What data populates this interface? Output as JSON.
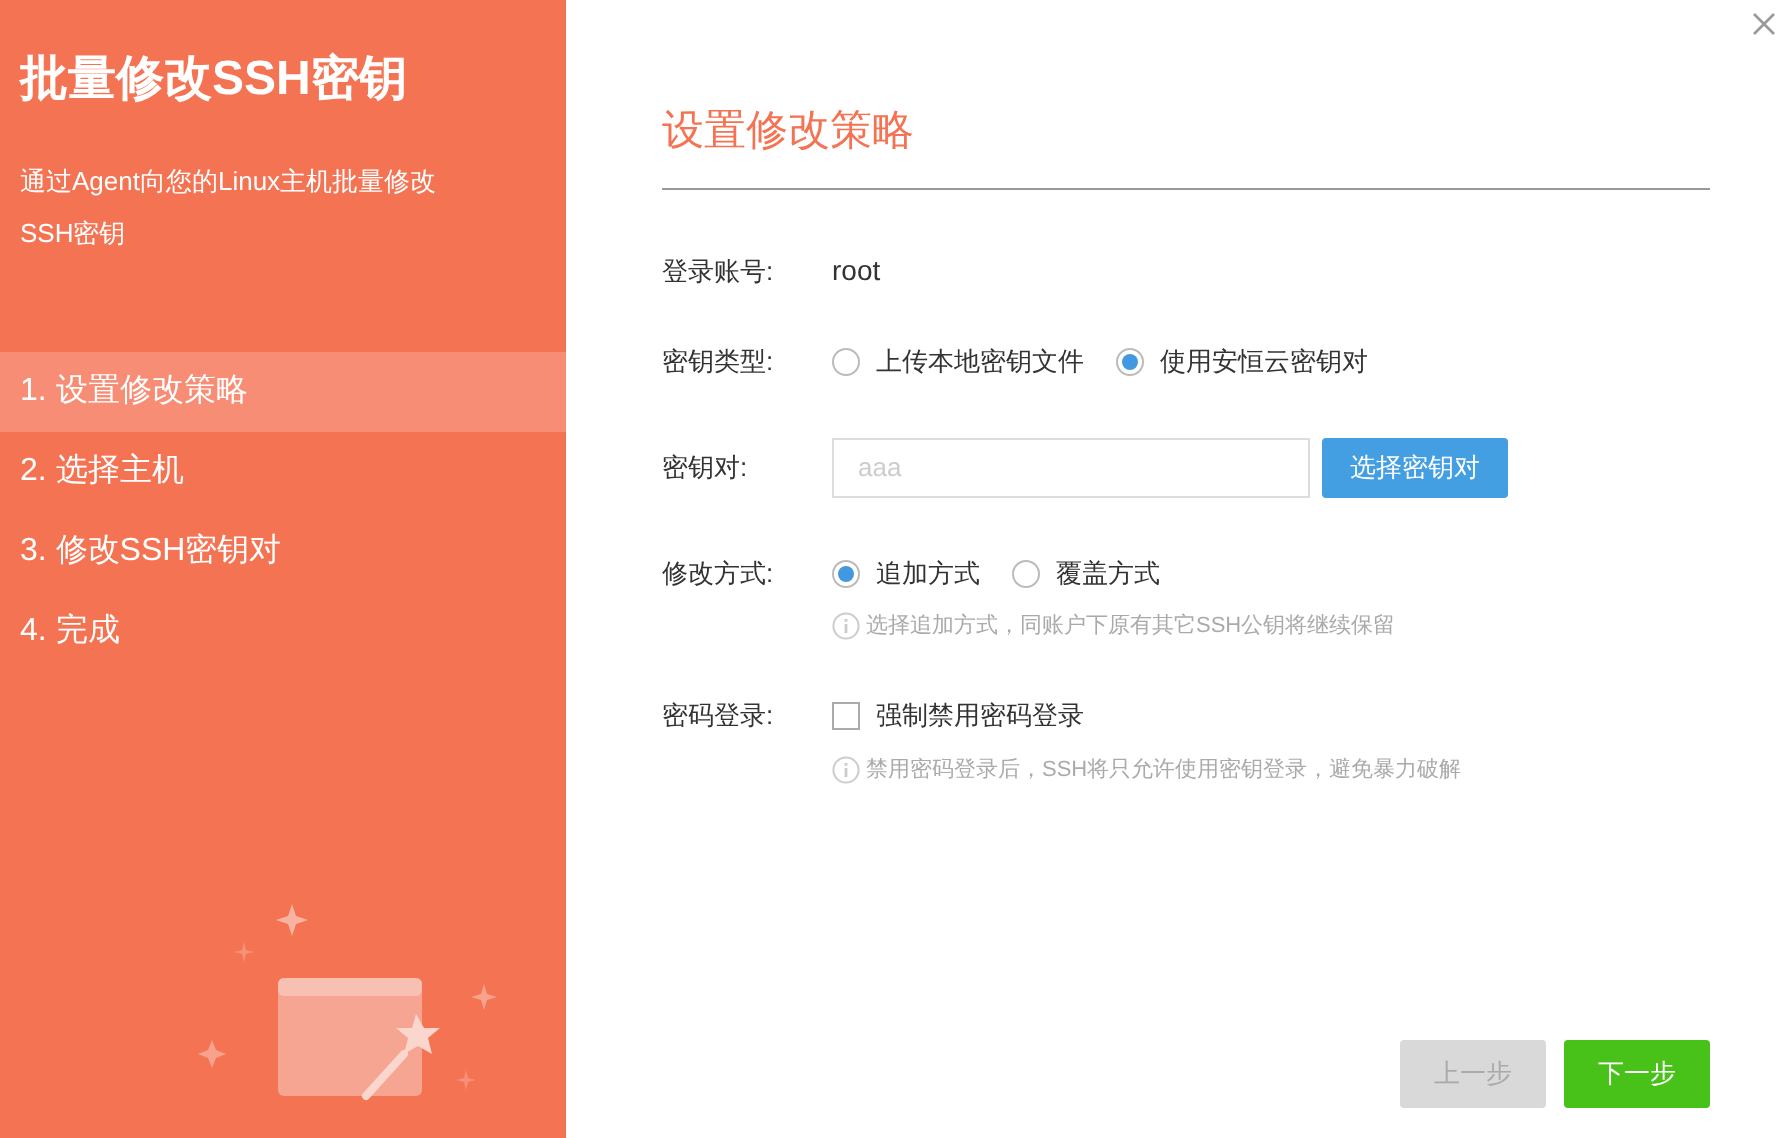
{
  "sidebar": {
    "title": "批量修改SSH密钥",
    "description": "通过Agent向您的Linux主机批量修改SSH密钥",
    "steps": [
      {
        "label": "1. 设置修改策略",
        "selected": true
      },
      {
        "label": "2. 选择主机",
        "selected": false
      },
      {
        "label": "3. 修改SSH密钥对",
        "selected": false
      },
      {
        "label": "4. 完成",
        "selected": false
      }
    ]
  },
  "form": {
    "heading": "设置修改策略",
    "rows": [
      {
        "kind": "text",
        "label": "登录账号:",
        "value": "root"
      },
      {
        "kind": "radio",
        "label": "密钥类型:",
        "options": [
          {
            "label": "上传本地密钥文件",
            "selected": false
          },
          {
            "label": "使用安恒云密钥对",
            "selected": true
          }
        ]
      },
      {
        "kind": "input",
        "label": "密钥对:",
        "placeholder": "aaa",
        "button": "选择密钥对"
      },
      {
        "kind": "radio",
        "label": "修改方式:",
        "options": [
          {
            "label": "追加方式",
            "selected": true
          },
          {
            "label": "覆盖方式",
            "selected": false
          }
        ],
        "hint": "选择追加方式，同账户下原有其它SSH公钥将继续保留"
      },
      {
        "kind": "checkbox",
        "label": "密码登录:",
        "option": {
          "label": "强制禁用密码登录",
          "checked": false
        },
        "hint": "禁用密码登录后，SSH将只允许使用密钥登录，避免暴力破解"
      }
    ]
  },
  "footer": {
    "buttons": [
      {
        "label": "上一步",
        "kind": "prev",
        "disabled": true
      },
      {
        "label": "下一步",
        "kind": "next",
        "disabled": false
      }
    ]
  }
}
